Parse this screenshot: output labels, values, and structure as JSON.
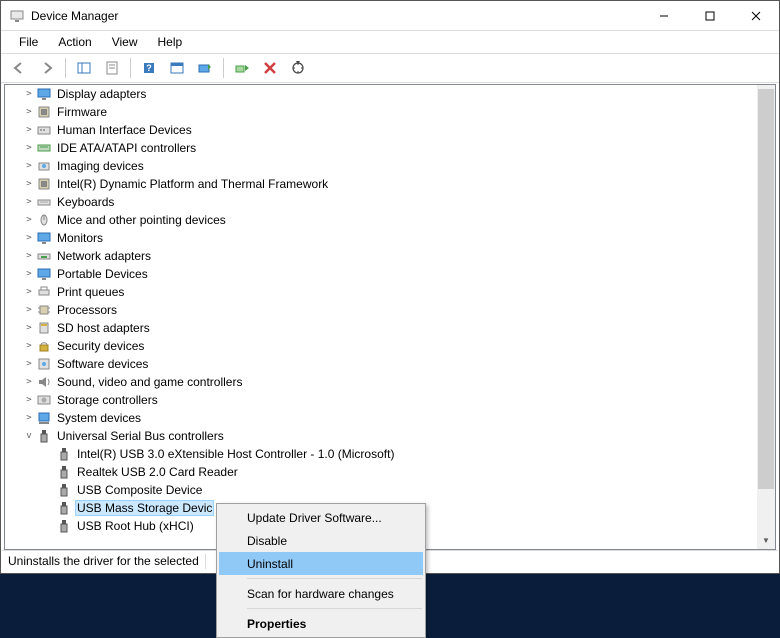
{
  "window": {
    "title": "Device Manager"
  },
  "menu": {
    "file": "File",
    "action": "Action",
    "view": "View",
    "help": "Help"
  },
  "tree": {
    "items": [
      {
        "label": "Display adapters",
        "icon": "monitor"
      },
      {
        "label": "Firmware",
        "icon": "chip"
      },
      {
        "label": "Human Interface Devices",
        "icon": "hid"
      },
      {
        "label": "IDE ATA/ATAPI controllers",
        "icon": "ide"
      },
      {
        "label": "Imaging devices",
        "icon": "camera"
      },
      {
        "label": "Intel(R) Dynamic Platform and Thermal Framework",
        "icon": "chip"
      },
      {
        "label": "Keyboards",
        "icon": "keyboard"
      },
      {
        "label": "Mice and other pointing devices",
        "icon": "mouse"
      },
      {
        "label": "Monitors",
        "icon": "monitor"
      },
      {
        "label": "Network adapters",
        "icon": "net"
      },
      {
        "label": "Portable Devices",
        "icon": "monitor"
      },
      {
        "label": "Print queues",
        "icon": "printer"
      },
      {
        "label": "Processors",
        "icon": "cpu"
      },
      {
        "label": "SD host adapters",
        "icon": "sd"
      },
      {
        "label": "Security devices",
        "icon": "lock"
      },
      {
        "label": "Software devices",
        "icon": "soft"
      },
      {
        "label": "Sound, video and game controllers",
        "icon": "sound"
      },
      {
        "label": "Storage controllers",
        "icon": "storage"
      },
      {
        "label": "System devices",
        "icon": "system"
      }
    ],
    "usb": {
      "label": "Universal Serial Bus controllers",
      "children": [
        "Intel(R) USB 3.0 eXtensible Host Controller - 1.0 (Microsoft)",
        "Realtek USB 2.0 Card Reader",
        "USB Composite Device",
        "USB Mass Storage Device",
        "USB Root Hub (xHCI)"
      ],
      "selectedIndex": 3
    }
  },
  "context": {
    "update": "Update Driver Software...",
    "disable": "Disable",
    "uninstall": "Uninstall",
    "scan": "Scan for hardware changes",
    "properties": "Properties"
  },
  "status": "Uninstalls the driver for the selected device."
}
